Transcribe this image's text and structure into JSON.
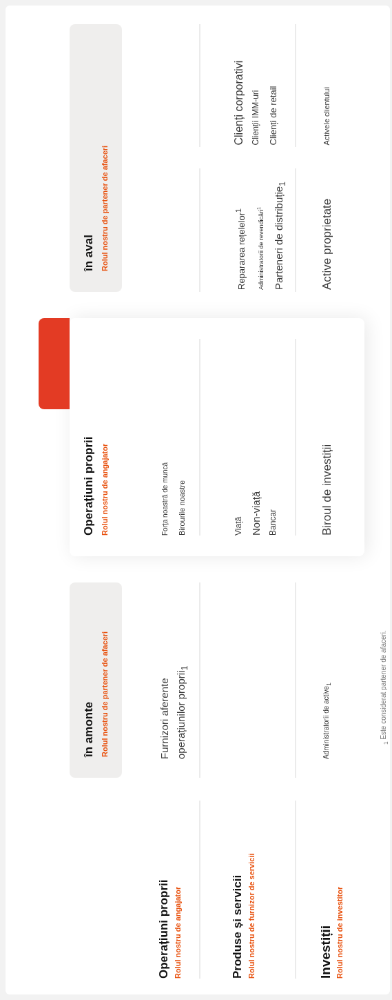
{
  "row_headers": [
    {
      "title": "Operațiuni proprii",
      "subtitle": "Rolul nostru de angajator"
    },
    {
      "title": "Produse și servicii",
      "subtitle": "Rolul nostru de furnizor de servicii"
    },
    {
      "title": "Investiții",
      "subtitle": "Rolul nostru de investitor"
    }
  ],
  "columns": [
    {
      "kind": "shaded",
      "title": "în amonte",
      "subtitle": "Rolul nostru de partener de afaceri",
      "groups": [
        {
          "own_operations": [
            "Furnizori aferente operațiunilor proprii$_{1}$"
          ],
          "investments": [
            "Administratorii de active$_{1}$"
          ]
        }
      ]
    },
    {
      "kind": "highlighted",
      "title": "Operațiuni proprii",
      "subtitle": "Rolul nostru de angajator",
      "groups": [
        {
          "own_operations": [
            "Forța noastră de muncă",
            "Birourile noastre"
          ],
          "products_services": [
            "Viață",
            "Non-viață",
            "Bancar"
          ],
          "investments": [
            "Biroul de investiții"
          ]
        }
      ]
    },
    {
      "kind": "shaded",
      "title": "în aval",
      "subtitle": "Rolul nostru de partener de afaceri",
      "groups": [
        {
          "products_services": [
            "Repararea rețelelor$^{1}$",
            "Administratorii de revendicări$^{1}$",
            "Parteneri de distribuție$_{1}$"
          ],
          "investments": [
            "Active proprietate"
          ]
        },
        {
          "products_services": [
            "Clienți corporativi",
            "Clienții IMM-uri",
            "Clienți de retail"
          ],
          "investments": [
            "Activele clientului"
          ]
        }
      ]
    }
  ],
  "footnote": "$_{1}$ Este considerat partener de afaceri."
}
